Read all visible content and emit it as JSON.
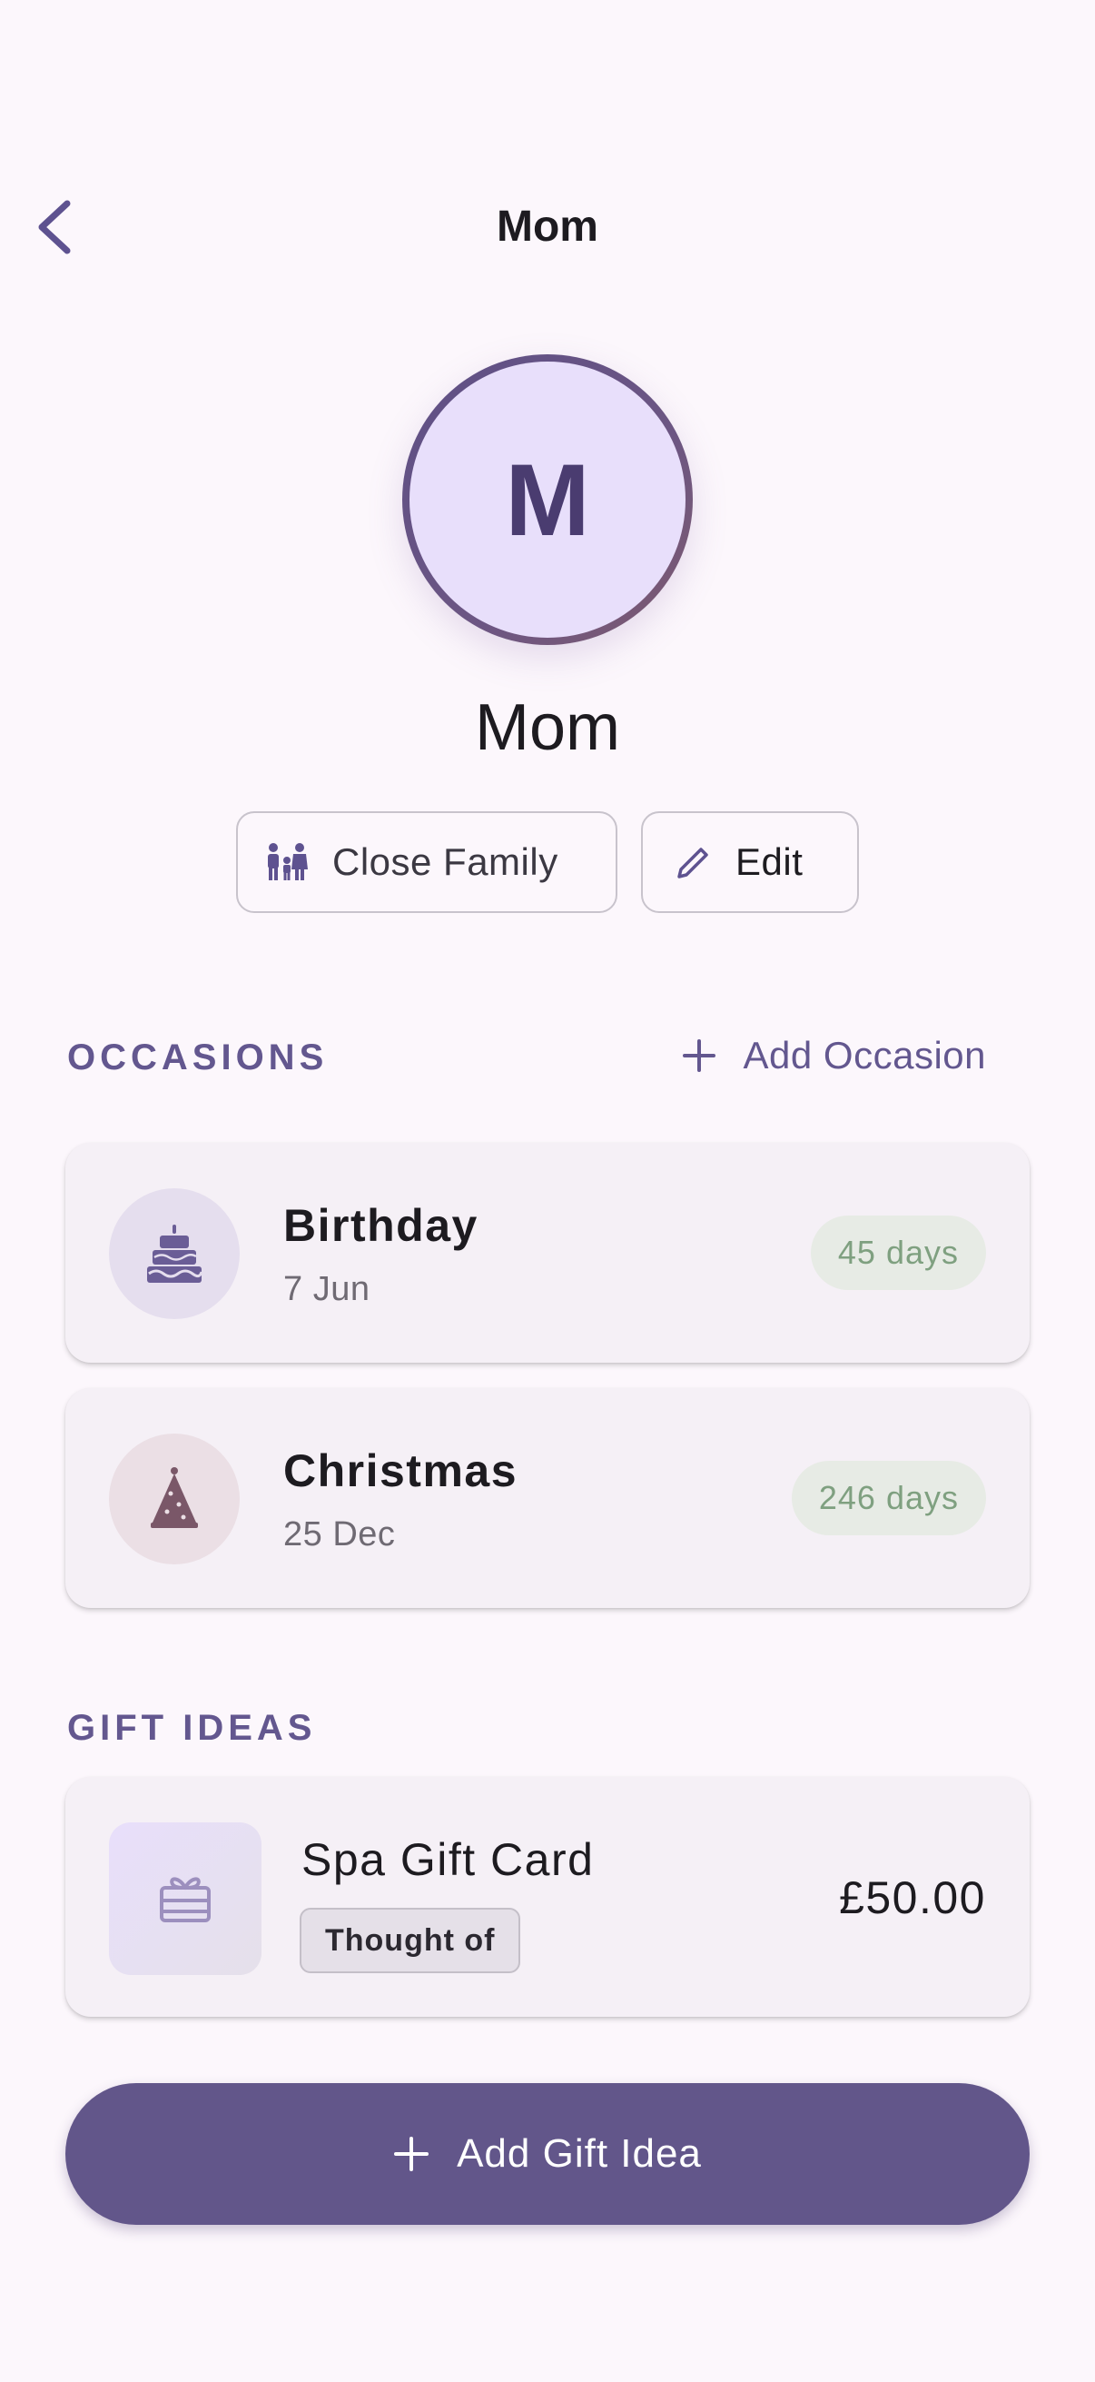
{
  "app_bar": {
    "title": "Mom",
    "back_icon": "chevron-left-icon"
  },
  "profile": {
    "avatar_initial": "M",
    "name": "Mom",
    "relationship_chip": {
      "label": "Close Family",
      "icon": "family-icon"
    },
    "edit_chip": {
      "label": "Edit",
      "icon": "pencil-icon"
    }
  },
  "occasions": {
    "section_title": "OCCASIONS",
    "add_label": "Add Occasion",
    "items": [
      {
        "title": "Birthday",
        "date": "7 Jun",
        "countdown": "45 days",
        "icon": "cake-icon"
      },
      {
        "title": "Christmas",
        "date": "25 Dec",
        "countdown": "246 days",
        "icon": "party-hat-icon"
      }
    ]
  },
  "gift_ideas": {
    "section_title": "GIFT IDEAS",
    "items": [
      {
        "title": "Spa Gift Card",
        "status": "Thought of",
        "price": "£50.00",
        "icon": "gift-icon"
      }
    ]
  },
  "primary_action": {
    "label": "Add Gift Idea",
    "icon": "plus-icon"
  },
  "colors": {
    "background": "#FCF7FC",
    "primary": "#62568A",
    "accent_text": "#63578F",
    "countdown_text": "#7FA080",
    "card": "#F5F0F6"
  }
}
